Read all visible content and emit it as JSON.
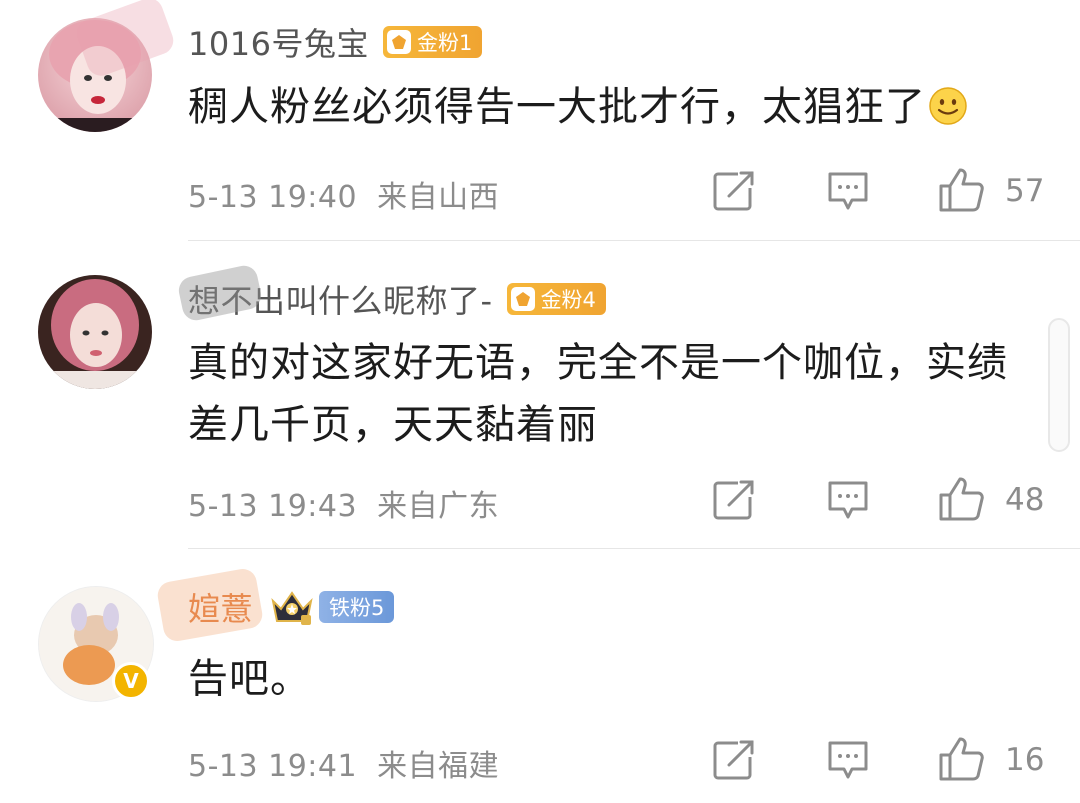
{
  "comments": [
    {
      "username": "1016号兔宝",
      "badge": {
        "label": "金粉1",
        "type": "gold"
      },
      "text": "稠人粉丝必须得告一大批才行，太猖狂了",
      "emoji": "smile-emoji",
      "time": "5-13 19:40",
      "location": "来自山西",
      "likes": "57"
    },
    {
      "username": "想不出叫什么昵称了-",
      "badge": {
        "label": "金粉4",
        "type": "gold"
      },
      "text": "真的对这家好无语，完全不是一个咖位，实绩差几千页，天天黏着丽",
      "time": "5-13 19:43",
      "location": "来自广东",
      "likes": "48"
    },
    {
      "username": "媗薏",
      "badge": {
        "label": "铁粉5",
        "type": "iron"
      },
      "crown": "crown-icon",
      "text": "告吧。",
      "time": "5-13 19:41",
      "location": "来自福建",
      "likes": "16"
    }
  ],
  "icons": {
    "share": "share-icon",
    "comment": "comment-icon",
    "like": "thumbs-up-icon",
    "verified": "verified-v-icon"
  },
  "verified_label": "V",
  "colors": {
    "gold_badge": "#f0a431",
    "iron_badge": "#6b98d9",
    "meta_text": "#8c8c8c",
    "verified": "#f3b400"
  }
}
